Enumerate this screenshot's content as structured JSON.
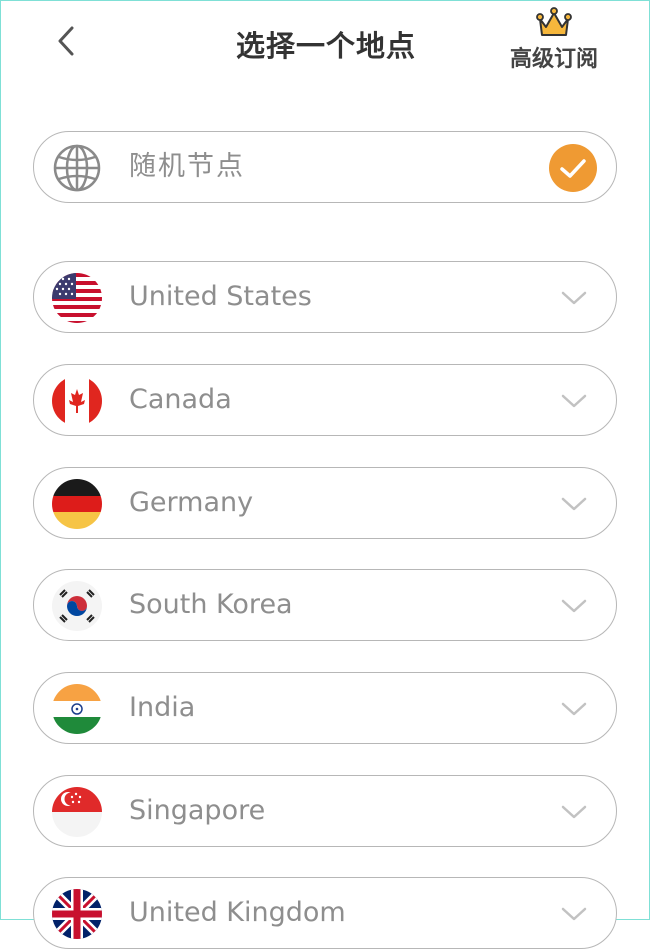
{
  "header": {
    "title": "选择一个地点",
    "premium_label": "高级订阅"
  },
  "random_node": {
    "label": "随机节点",
    "selected": true
  },
  "countries": [
    {
      "name": "United States",
      "flag": "us-flag"
    },
    {
      "name": "Canada",
      "flag": "canada-flag"
    },
    {
      "name": "Germany",
      "flag": "germany-flag"
    },
    {
      "name": "South Korea",
      "flag": "south-korea-flag"
    },
    {
      "name": "India",
      "flag": "india-flag"
    },
    {
      "name": "Singapore",
      "flag": "singapore-flag"
    },
    {
      "name": "United Kingdom",
      "flag": "uk-flag"
    }
  ],
  "colors": {
    "accent": "#ef9a33",
    "text_muted": "#8e8e8e",
    "border": "#b7b7b7"
  },
  "icons": {
    "back": "chevron-left-icon",
    "premium": "crown-icon",
    "random": "globe-icon",
    "selected": "check-circle-icon",
    "expand": "chevron-down-icon"
  }
}
